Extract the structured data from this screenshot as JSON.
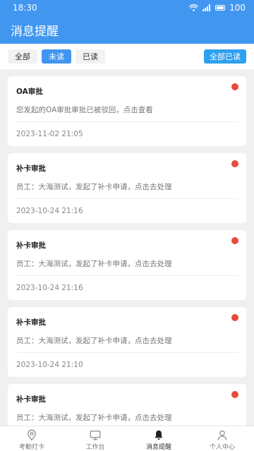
{
  "status_bar": {
    "time": "18:30",
    "battery": "100",
    "icons": [
      "wifi-icon",
      "signal-icon",
      "battery-icon"
    ]
  },
  "header": {
    "title": "消息提醒"
  },
  "filters": {
    "all": "全部",
    "unread": "未读",
    "read": "已读",
    "selected": "未读",
    "mark_all_read": "全部已读"
  },
  "messages": [
    {
      "title": "OA审批",
      "desc": "您发起的OA审批审批已被驳回，点击查看",
      "time": "2023-11-02 21:05",
      "unread": true
    },
    {
      "title": "补卡审批",
      "desc": "员工：大海测试，发起了补卡申请，点击去处理",
      "time": "2023-10-24 21:16",
      "unread": true
    },
    {
      "title": "补卡审批",
      "desc": "员工：大海测试，发起了补卡申请，点击去处理",
      "time": "2023-10-24 21:16",
      "unread": true
    },
    {
      "title": "补卡审批",
      "desc": "员工：大海测试，发起了补卡申请，点击去处理",
      "time": "2023-10-24 21:10",
      "unread": true
    },
    {
      "title": "补卡审批",
      "desc": "员工：大海测试，发起了补卡申请，点击去处理",
      "time": "",
      "unread": true
    }
  ],
  "tabbar": {
    "items": [
      {
        "label": "考勤打卡",
        "icon": "location-pin-icon"
      },
      {
        "label": "工作台",
        "icon": "monitor-icon"
      },
      {
        "label": "消息提醒",
        "icon": "bell-icon"
      },
      {
        "label": "个人中心",
        "icon": "user-icon"
      }
    ],
    "active": "消息提醒"
  },
  "colors": {
    "primary": "#4196f0",
    "unread_dot": "#e84a3c",
    "background": "#f0f0f0"
  }
}
